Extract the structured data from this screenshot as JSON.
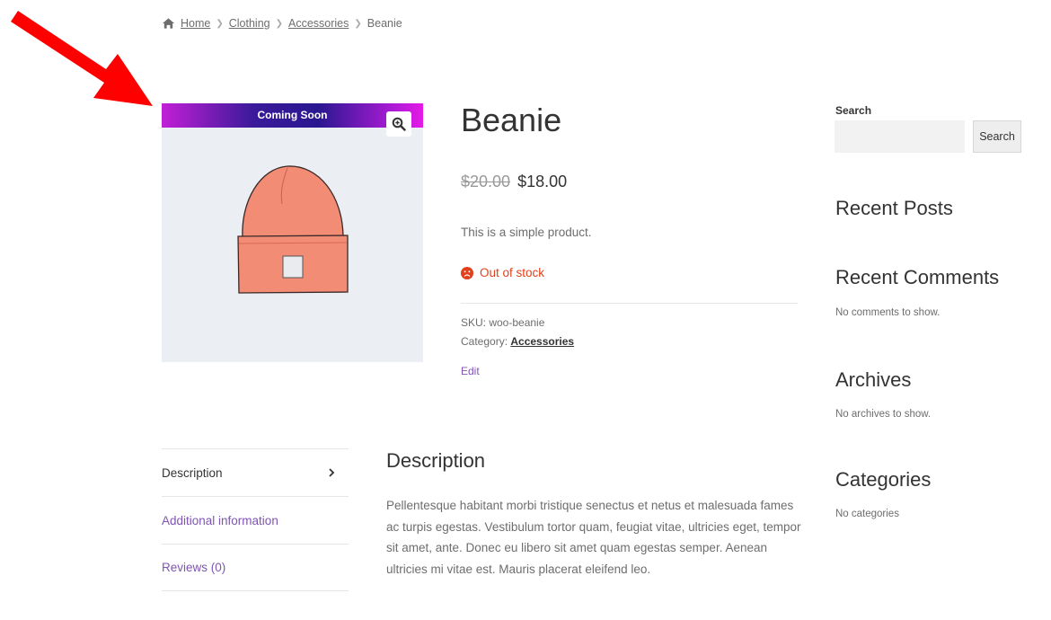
{
  "breadcrumb": {
    "home": "Home",
    "clothing": "Clothing",
    "accessories": "Accessories",
    "current": "Beanie",
    "home_icon": "home-icon"
  },
  "product": {
    "badge": "Coming Soon",
    "title": "Beanie",
    "old_price": "$20.00",
    "price": "$18.00",
    "short_description": "This is a simple product.",
    "stock_status": "Out of stock",
    "sku_label": "SKU: ",
    "sku": "woo-beanie",
    "category_label": "Category: ",
    "category": "Accessories",
    "edit": "Edit"
  },
  "sidebar": {
    "search_label": "Search",
    "search_value": "",
    "search_button": "Search",
    "recent_posts_title": "Recent Posts",
    "recent_comments_title": "Recent Comments",
    "recent_comments_text": "No comments to show.",
    "archives_title": "Archives",
    "archives_text": "No archives to show.",
    "categories_title": "Categories",
    "categories_text": "No categories"
  },
  "tabs": {
    "description": "Description",
    "additional": "Additional information",
    "reviews": "Reviews (0)"
  },
  "description": {
    "title": "Description",
    "body": "Pellentesque habitant morbi tristique senectus et netus et malesuada fames ac turpis egestas. Vestibulum tortor quam, feugiat vitae, ultricies eget, tempor sit amet, ante. Donec eu libero sit amet quam egestas semper. Aenean ultricies mi vitae est. Mauris placerat eleifend leo."
  },
  "colors": {
    "accent": "#7f54b3",
    "out_of_stock": "#e2401c",
    "arrow": "#ff0000"
  }
}
